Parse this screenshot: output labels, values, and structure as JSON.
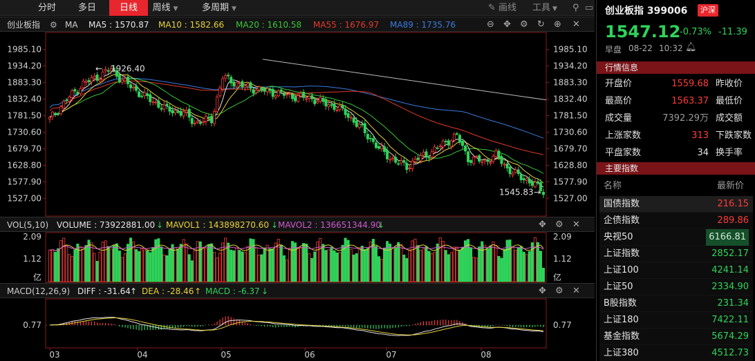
{
  "toolbar": {
    "tabs": [
      {
        "label": "分时",
        "active": false
      },
      {
        "label": "多日",
        "active": false
      },
      {
        "label": "日线",
        "active": true
      },
      {
        "label": "周线",
        "active": false
      },
      {
        "label": "多周期",
        "active": false
      }
    ],
    "draw_label": "画线",
    "tools_label": "工具",
    "pin_icon": "pin-icon",
    "window_icon": "window-icon"
  },
  "price_chart": {
    "name": "创业板指",
    "ma_label": "MA",
    "ma5": "MA5 : 1570.87",
    "ma10": "MA10 : 1582.66",
    "ma20": "MA20 : 1610.58",
    "ma55": "MA55 : 1676.97",
    "ma89": "MA89 : 1735.76",
    "high_marker": "1926.40",
    "low_marker": "1545.83",
    "y_ticks": [
      "1985.10",
      "1934.20",
      "1883.30",
      "1832.40",
      "1781.50",
      "1730.60",
      "1679.70",
      "1628.80",
      "1577.90",
      "1527.00"
    ]
  },
  "volume_chart": {
    "name": "VOL(5,10)",
    "volume": "VOLUME : 73922881.00",
    "mavol1": "MAVOL1 : 143898270.60",
    "mavol2": "MAVOL2 : 136651344.90",
    "y_ticks": [
      "2.09",
      "1.12",
      "亿"
    ]
  },
  "macd_chart": {
    "name": "MACD(12,26,9)",
    "diff": "DIFF : -31.64",
    "dea": "DEA : -28.46",
    "macd": "MACD : -6.37",
    "y_tick": "0.77"
  },
  "x_axis": [
    "03",
    "04",
    "05",
    "06",
    "07",
    "08"
  ],
  "quote": {
    "title": "创业板指 399006",
    "market_badge": "沪深",
    "price": "1547.12",
    "change_pct": "-0.73%",
    "change": "-11.39",
    "session": "早盘",
    "date": "08-22",
    "time": "10:32",
    "bell_icon": "bell-icon"
  },
  "market_info": {
    "header": "行情信息",
    "rows": [
      {
        "l1": "开盘价",
        "v1": "1559.68",
        "c1": "red",
        "l2": "昨收价"
      },
      {
        "l1": "最高价",
        "v1": "1563.37",
        "c1": "red",
        "l2": "最低价"
      },
      {
        "l1": "成交量",
        "v1": "7392.29万",
        "c1": "gray",
        "l2": "成交额"
      },
      {
        "l1": "上涨家数",
        "v1": "313",
        "c1": "red",
        "l2": "下跌家数"
      },
      {
        "l1": "平盘家数",
        "v1": "34",
        "c1": "white",
        "l2": "换手率"
      }
    ]
  },
  "indices": {
    "header": "主要指数",
    "col_name": "名称",
    "col_price": "最新价",
    "rows": [
      {
        "name": "国债指数",
        "price": "216.15",
        "color": "red"
      },
      {
        "name": "企债指数",
        "price": "289.86",
        "color": "red"
      },
      {
        "name": "央视50",
        "price": "6166.81",
        "color": "green",
        "highlight": true
      },
      {
        "name": "上证指数",
        "price": "2852.17",
        "color": "green"
      },
      {
        "name": "上证100",
        "price": "4241.14",
        "color": "green"
      },
      {
        "name": "上证50",
        "price": "2334.90",
        "color": "green"
      },
      {
        "name": "B股指数",
        "price": "231.34",
        "color": "green"
      },
      {
        "name": "上证180",
        "price": "7422.11",
        "color": "green"
      },
      {
        "name": "基金指数",
        "price": "5674.29",
        "color": "green"
      },
      {
        "name": "上证380",
        "price": "4512.73",
        "color": "green"
      }
    ]
  },
  "colors": {
    "up": "#ff3b3b",
    "down": "#2fd35a",
    "ma5": "#e6e6e6",
    "ma10": "#e8d23a",
    "ma20": "#3ac83a",
    "ma55": "#e23a2a",
    "ma89": "#3a7be0",
    "accent": "#e8262d"
  },
  "chart_data": {
    "type": "candlestick",
    "x_months": [
      "03",
      "04",
      "05",
      "06",
      "07",
      "08"
    ],
    "y_range": [
      1527.0,
      1985.1
    ],
    "highest": 1926.4,
    "lowest": 1545.83,
    "last": 1547.12,
    "moving_averages": {
      "MA5": 1570.87,
      "MA10": 1582.66,
      "MA20": 1610.58,
      "MA55": 1676.97,
      "MA89": 1735.76
    },
    "volume_y_ticks": [
      1.12,
      2.09
    ],
    "macd": {
      "DIFF": -31.64,
      "DEA": -28.46,
      "MACD": -6.37
    },
    "macd_y_tick": 0.77
  }
}
